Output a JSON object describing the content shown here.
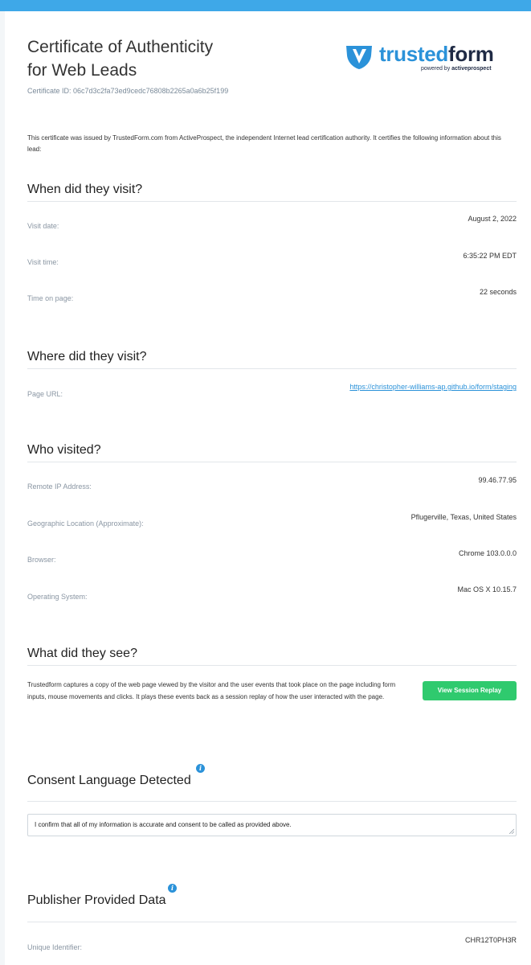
{
  "header": {
    "title_line1": "Certificate of Authenticity",
    "title_line2": "for Web Leads",
    "certificate_id": "Certificate ID: 06c7d3c2fa73ed9cedc76808b2265a0a6b25f199"
  },
  "logo": {
    "word_part1": "trusted",
    "word_part2": "form",
    "sub_prefix": "powered by ",
    "sub_brand": "activeprospect",
    "brand_color": "#2b92d9",
    "dark_color": "#1f2a44"
  },
  "intro": "This certificate was issued by TrustedForm.com from ActiveProspect, the independent Internet lead certification authority. It certifies the following information about this lead:",
  "when": {
    "title": "When did they visit?",
    "rows": [
      {
        "label": "Visit date:",
        "value": "August 2, 2022"
      },
      {
        "label": "Visit time:",
        "value": "6:35:22 PM EDT"
      },
      {
        "label": "Time on page:",
        "value": "22 seconds"
      }
    ]
  },
  "where": {
    "title": "Where did they visit?",
    "rows": [
      {
        "label": "Page URL:",
        "value": "https://christopher-williams-ap.github.io/form/staging"
      }
    ]
  },
  "who": {
    "title": "Who visited?",
    "rows": [
      {
        "label": "Remote IP Address:",
        "value": "99.46.77.95"
      },
      {
        "label": "Geographic Location (Approximate):",
        "value": "Pflugerville, Texas, United States"
      },
      {
        "label": "Browser:",
        "value": "Chrome 103.0.0.0"
      },
      {
        "label": "Operating System:",
        "value": "Mac OS X 10.15.7"
      }
    ]
  },
  "see": {
    "title": "What did they see?",
    "text": "Trustedform captures a copy of the web page viewed by the visitor and the user events that took place on the page including form inputs, mouse movements and clicks. It plays these events back as a session replay of how the user interacted with the page.",
    "button_label": "View Session Replay",
    "button_color": "#2fca6e"
  },
  "consent": {
    "title": "Consent Language Detected",
    "info_icon": "i",
    "text": "I confirm that all of my information is accurate and consent to be called as provided above."
  },
  "publisher": {
    "title": "Publisher Provided Data",
    "info_icon": "i",
    "rows": [
      {
        "label": "Unique Identifier:",
        "value": "CHR12T0PH3R"
      }
    ]
  },
  "colors": {
    "top_bar": "#3ea8e8",
    "label": "#8a96a3",
    "link": "#2b92d9"
  }
}
